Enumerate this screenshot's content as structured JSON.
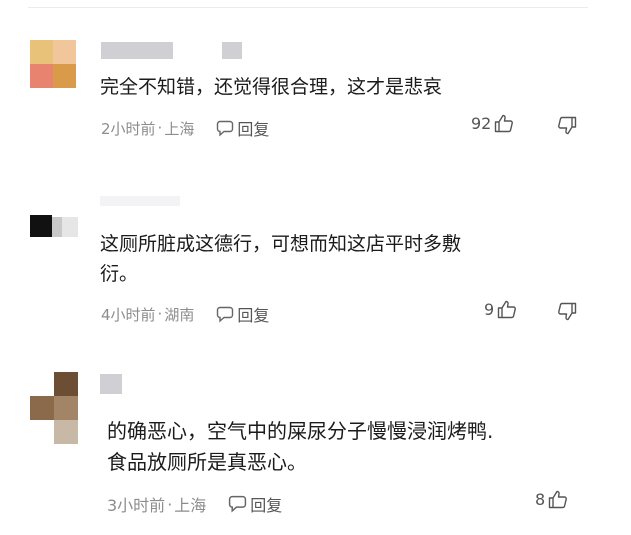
{
  "comments": [
    {
      "text": [
        "完全不知错，还觉得很合理，这才是悲哀"
      ],
      "time": "2小时前",
      "location": "上海",
      "reply_label": "回复",
      "likes": "92",
      "avatar_colors": [
        "#e9c27a",
        "#f0c69a",
        "#e8836f",
        "#d99a4a"
      ]
    },
    {
      "text": [
        "这厕所脏成这德行，可想而知这店平时多敷",
        "衍。"
      ],
      "time": "4小时前",
      "location": "湖南",
      "reply_label": "回复",
      "likes": "9",
      "avatar_colors": [
        "#111111",
        "#9a9a9a",
        "#e6e6e6"
      ]
    },
    {
      "text": [
        "的确恶心，空气中的屎尿分子慢慢浸润烤鸭.",
        "食品放厕所是真恶心。"
      ],
      "time": "3小时前",
      "location": "上海",
      "reply_label": "回复",
      "likes": "8",
      "avatar_colors": [
        "#8a6a4a",
        "#6b4e33",
        "#a48466",
        "#c8b9a6"
      ]
    }
  ],
  "separator": "·",
  "colors": {
    "text": "#1b1b1b",
    "meta": "#8d8d8d",
    "placeholder": "#cfcfd4"
  }
}
